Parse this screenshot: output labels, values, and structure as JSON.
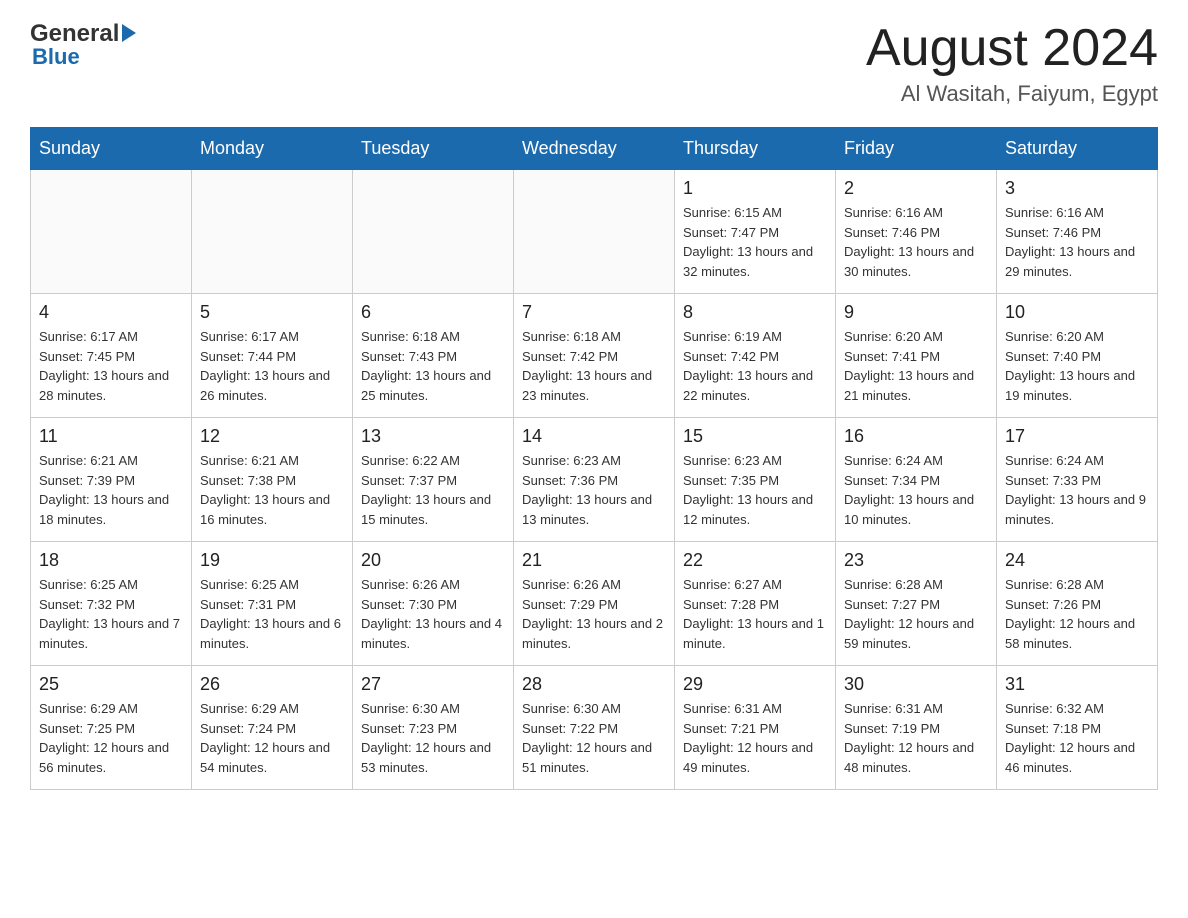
{
  "header": {
    "logo": {
      "general": "General",
      "arrow": "▶",
      "blue": "Blue"
    },
    "title": "August 2024",
    "location": "Al Wasitah, Faiyum, Egypt"
  },
  "calendar": {
    "days_of_week": [
      "Sunday",
      "Monday",
      "Tuesday",
      "Wednesday",
      "Thursday",
      "Friday",
      "Saturday"
    ],
    "weeks": [
      [
        {
          "day": "",
          "info": ""
        },
        {
          "day": "",
          "info": ""
        },
        {
          "day": "",
          "info": ""
        },
        {
          "day": "",
          "info": ""
        },
        {
          "day": "1",
          "info": "Sunrise: 6:15 AM\nSunset: 7:47 PM\nDaylight: 13 hours and 32 minutes."
        },
        {
          "day": "2",
          "info": "Sunrise: 6:16 AM\nSunset: 7:46 PM\nDaylight: 13 hours and 30 minutes."
        },
        {
          "day": "3",
          "info": "Sunrise: 6:16 AM\nSunset: 7:46 PM\nDaylight: 13 hours and 29 minutes."
        }
      ],
      [
        {
          "day": "4",
          "info": "Sunrise: 6:17 AM\nSunset: 7:45 PM\nDaylight: 13 hours and 28 minutes."
        },
        {
          "day": "5",
          "info": "Sunrise: 6:17 AM\nSunset: 7:44 PM\nDaylight: 13 hours and 26 minutes."
        },
        {
          "day": "6",
          "info": "Sunrise: 6:18 AM\nSunset: 7:43 PM\nDaylight: 13 hours and 25 minutes."
        },
        {
          "day": "7",
          "info": "Sunrise: 6:18 AM\nSunset: 7:42 PM\nDaylight: 13 hours and 23 minutes."
        },
        {
          "day": "8",
          "info": "Sunrise: 6:19 AM\nSunset: 7:42 PM\nDaylight: 13 hours and 22 minutes."
        },
        {
          "day": "9",
          "info": "Sunrise: 6:20 AM\nSunset: 7:41 PM\nDaylight: 13 hours and 21 minutes."
        },
        {
          "day": "10",
          "info": "Sunrise: 6:20 AM\nSunset: 7:40 PM\nDaylight: 13 hours and 19 minutes."
        }
      ],
      [
        {
          "day": "11",
          "info": "Sunrise: 6:21 AM\nSunset: 7:39 PM\nDaylight: 13 hours and 18 minutes."
        },
        {
          "day": "12",
          "info": "Sunrise: 6:21 AM\nSunset: 7:38 PM\nDaylight: 13 hours and 16 minutes."
        },
        {
          "day": "13",
          "info": "Sunrise: 6:22 AM\nSunset: 7:37 PM\nDaylight: 13 hours and 15 minutes."
        },
        {
          "day": "14",
          "info": "Sunrise: 6:23 AM\nSunset: 7:36 PM\nDaylight: 13 hours and 13 minutes."
        },
        {
          "day": "15",
          "info": "Sunrise: 6:23 AM\nSunset: 7:35 PM\nDaylight: 13 hours and 12 minutes."
        },
        {
          "day": "16",
          "info": "Sunrise: 6:24 AM\nSunset: 7:34 PM\nDaylight: 13 hours and 10 minutes."
        },
        {
          "day": "17",
          "info": "Sunrise: 6:24 AM\nSunset: 7:33 PM\nDaylight: 13 hours and 9 minutes."
        }
      ],
      [
        {
          "day": "18",
          "info": "Sunrise: 6:25 AM\nSunset: 7:32 PM\nDaylight: 13 hours and 7 minutes."
        },
        {
          "day": "19",
          "info": "Sunrise: 6:25 AM\nSunset: 7:31 PM\nDaylight: 13 hours and 6 minutes."
        },
        {
          "day": "20",
          "info": "Sunrise: 6:26 AM\nSunset: 7:30 PM\nDaylight: 13 hours and 4 minutes."
        },
        {
          "day": "21",
          "info": "Sunrise: 6:26 AM\nSunset: 7:29 PM\nDaylight: 13 hours and 2 minutes."
        },
        {
          "day": "22",
          "info": "Sunrise: 6:27 AM\nSunset: 7:28 PM\nDaylight: 13 hours and 1 minute."
        },
        {
          "day": "23",
          "info": "Sunrise: 6:28 AM\nSunset: 7:27 PM\nDaylight: 12 hours and 59 minutes."
        },
        {
          "day": "24",
          "info": "Sunrise: 6:28 AM\nSunset: 7:26 PM\nDaylight: 12 hours and 58 minutes."
        }
      ],
      [
        {
          "day": "25",
          "info": "Sunrise: 6:29 AM\nSunset: 7:25 PM\nDaylight: 12 hours and 56 minutes."
        },
        {
          "day": "26",
          "info": "Sunrise: 6:29 AM\nSunset: 7:24 PM\nDaylight: 12 hours and 54 minutes."
        },
        {
          "day": "27",
          "info": "Sunrise: 6:30 AM\nSunset: 7:23 PM\nDaylight: 12 hours and 53 minutes."
        },
        {
          "day": "28",
          "info": "Sunrise: 6:30 AM\nSunset: 7:22 PM\nDaylight: 12 hours and 51 minutes."
        },
        {
          "day": "29",
          "info": "Sunrise: 6:31 AM\nSunset: 7:21 PM\nDaylight: 12 hours and 49 minutes."
        },
        {
          "day": "30",
          "info": "Sunrise: 6:31 AM\nSunset: 7:19 PM\nDaylight: 12 hours and 48 minutes."
        },
        {
          "day": "31",
          "info": "Sunrise: 6:32 AM\nSunset: 7:18 PM\nDaylight: 12 hours and 46 minutes."
        }
      ]
    ]
  }
}
